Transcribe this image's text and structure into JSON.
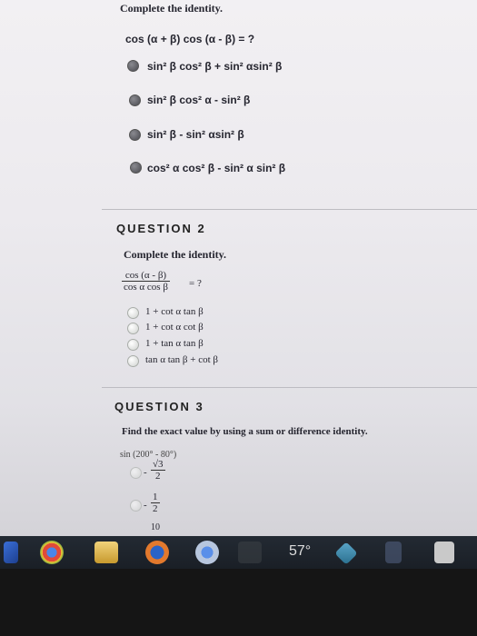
{
  "q1": {
    "heading": "Complete the identity.",
    "prompt": "cos (α + β) cos (α - β) = ?",
    "options": [
      "sin² β cos² β + sin² αsin² β",
      "sin² β cos² α - sin² β",
      "sin² β - sin² αsin² β",
      "cos² α cos² β - sin² α sin² β"
    ]
  },
  "q2": {
    "heading": "QUESTION 2",
    "prompt": "Complete the identity.",
    "frac_num": "cos (α - β)",
    "frac_den": "cos α cos β",
    "frac_tail": "= ?",
    "options": [
      "1 + cot α tan β",
      "1 + cot α cot β",
      "1 + tan α tan β",
      "tan α tan β + cot β"
    ]
  },
  "q3": {
    "heading": "QUESTION 3",
    "prompt": "Find the exact value by using a sum or difference identity.",
    "expr": "sin (200° - 80°)",
    "opt1_sign": "-",
    "opt1_num": "√3",
    "opt1_den": "2",
    "opt2_sign": "-",
    "opt2_num": "1",
    "opt2_den": "2",
    "partial": "10"
  },
  "taskbar": {
    "temperature": "57°"
  }
}
